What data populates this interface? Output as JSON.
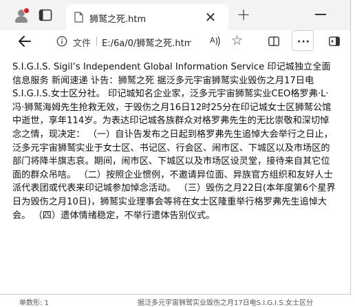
{
  "tab": {
    "title": "狮鹫之死.htm",
    "close_glyph": "✕",
    "new_tab_glyph": "+"
  },
  "toolbar": {
    "file_label": "文件",
    "url": "E:/6a/0/狮鹫之死.htm"
  },
  "article": {
    "text": "S.I.G.I.S. Sigil’s Independent Global Information Service 印记城独立全面信息服务 新闻速递 讣告：狮鹫之死 据泛多元宇宙狮鹫实业毁伤之月17日电S.I.G.I.S.女士区分社。 印记城知名企业家，泛多元宇宙狮鹫实业CEO格罗弗·L·冯·狮鹫海姆先生抢救无效，于毁伤之月16日12时25分在印记城女士区狮鹫公馆中逝世，享年114岁。为表达印记城各族群众对格罗弗先生的无比崇敬和深切悼念之情，现决定： （一）自讣告发布之日起到格罗弗先生追悼大会举行之日止，泛多元宇宙狮鹫实业于女士区、书记区、行会区、闹市区、下城区以及市场区的部门将降半旗志哀。期间，闹市区、下城区以及市场区设灵堂，接待来自其它位面的群众吊唁。 （二）按照企业惯例，不邀请异位面、异族官方组织和友好人士派代表团或代表来印记城参加悼念活动。 （三）毁伤之月22日(本年度第6个星界日为毁伤之月10日)，狮鹫实业理事会等将在女士区隆重举行格罗弗先生追悼大会。 （四）遗体情绪稳定，不举行遗体告别仪式。"
  },
  "background": {
    "left_text": "单数形: 1",
    "right_text": "据泛多元宇宙狮鹫实业毁伤之月17日电S.I.G.I.S.女士区分"
  }
}
